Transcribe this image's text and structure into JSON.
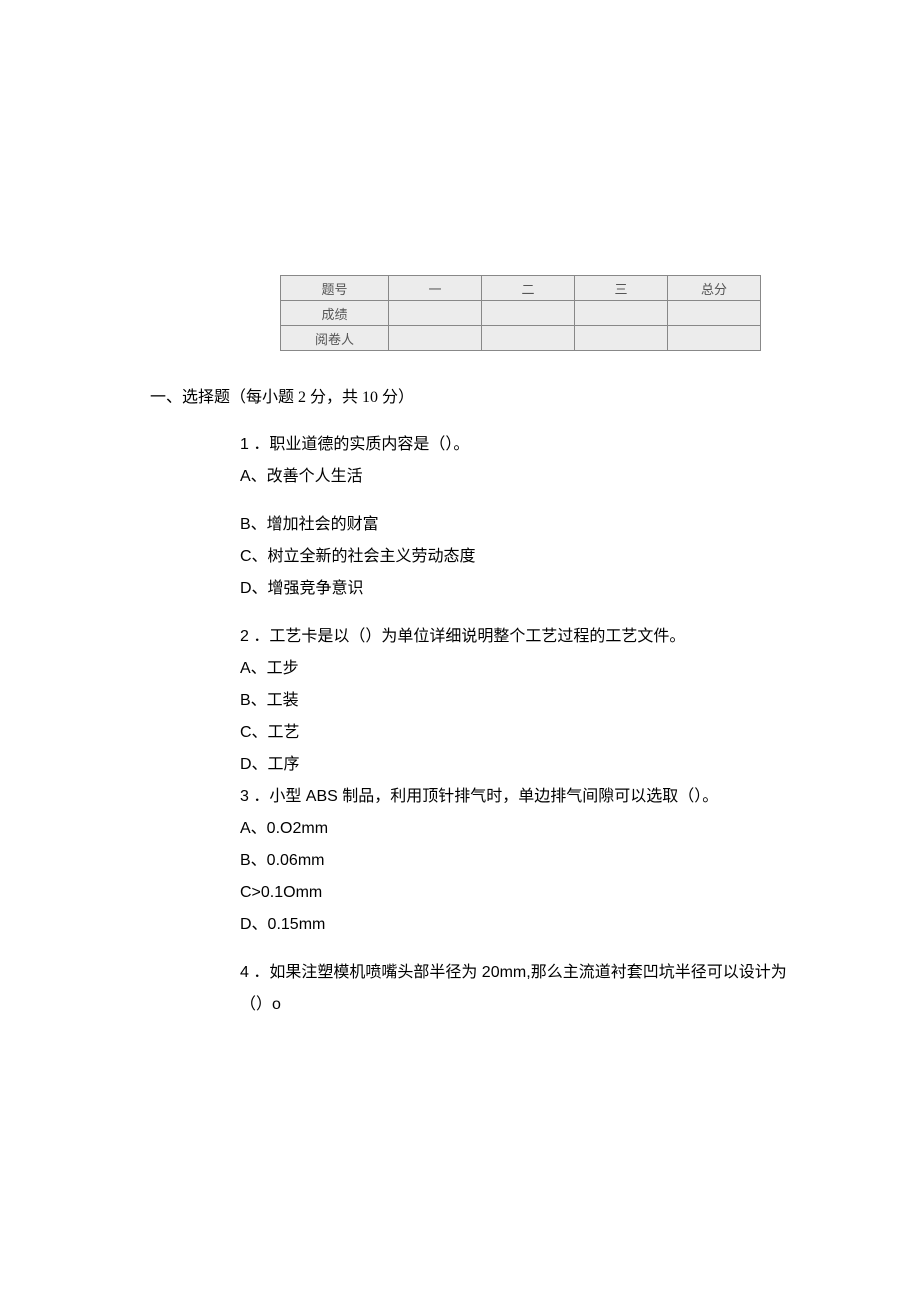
{
  "score_table": {
    "headers": [
      "题号",
      "一",
      "二",
      "三",
      "总分"
    ],
    "rows": [
      "成绩",
      "阅卷人"
    ]
  },
  "section1": {
    "title": "一、选择题（每小题 2 分，共 10 分）"
  },
  "q1": {
    "text": "1 ．职业道德的实质内容是（）。",
    "A": "A、改善个人生活",
    "B": "B、增加社会的财富",
    "C": "C、树立全新的社会主义劳动态度",
    "D": "D、增强竞争意识"
  },
  "q2": {
    "text": "2 ．工艺卡是以（）为单位详细说明整个工艺过程的工艺文件。",
    "A": "A、工步",
    "B": "B、工装",
    "C": "C、工艺",
    "D": "D、工序"
  },
  "q3": {
    "text": "3 ．小型 ABS 制品，利用顶针排气时，单边排气间隙可以选取（）。",
    "A": "A、0.O2mm",
    "B": "B、0.06mm",
    "C": "C>0.1Omm",
    "D": "D、0.15mm"
  },
  "q4": {
    "text": "4 ．如果注塑模机喷嘴头部半径为 20mm,那么主流道衬套凹坑半径可以设计为",
    "text2": "（）o"
  }
}
